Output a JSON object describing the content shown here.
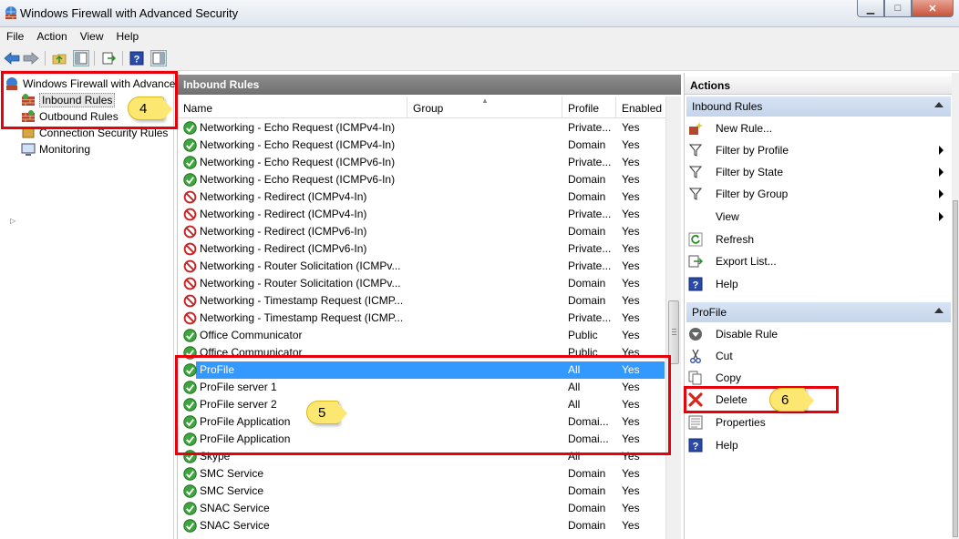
{
  "window": {
    "title": "Windows Firewall with Advanced Security",
    "min": "▁",
    "max": "□",
    "close": "✕"
  },
  "menu": [
    "File",
    "Action",
    "View",
    "Help"
  ],
  "tree": {
    "root": "Windows Firewall with Advance",
    "inbound": "Inbound Rules",
    "outbound": "Outbound Rules",
    "connection": "Connection Security Rules",
    "monitoring": "Monitoring"
  },
  "middle": {
    "header": "Inbound Rules",
    "columns": {
      "name": "Name",
      "group": "Group",
      "profile": "Profile",
      "enabled": "Enabled"
    },
    "rows": [
      {
        "status": "allow",
        "name": "Networking - Echo Request (ICMPv4-In)",
        "profile": "Private...",
        "enabled": "Yes"
      },
      {
        "status": "allow",
        "name": "Networking - Echo Request (ICMPv4-In)",
        "profile": "Domain",
        "enabled": "Yes"
      },
      {
        "status": "allow",
        "name": "Networking - Echo Request (ICMPv6-In)",
        "profile": "Private...",
        "enabled": "Yes"
      },
      {
        "status": "allow",
        "name": "Networking - Echo Request (ICMPv6-In)",
        "profile": "Domain",
        "enabled": "Yes"
      },
      {
        "status": "block",
        "name": "Networking - Redirect (ICMPv4-In)",
        "profile": "Domain",
        "enabled": "Yes"
      },
      {
        "status": "block",
        "name": "Networking - Redirect (ICMPv4-In)",
        "profile": "Private...",
        "enabled": "Yes"
      },
      {
        "status": "block",
        "name": "Networking - Redirect (ICMPv6-In)",
        "profile": "Domain",
        "enabled": "Yes"
      },
      {
        "status": "block",
        "name": "Networking - Redirect (ICMPv6-In)",
        "profile": "Private...",
        "enabled": "Yes"
      },
      {
        "status": "block",
        "name": "Networking - Router Solicitation (ICMPv...",
        "profile": "Private...",
        "enabled": "Yes"
      },
      {
        "status": "block",
        "name": "Networking - Router Solicitation (ICMPv...",
        "profile": "Domain",
        "enabled": "Yes"
      },
      {
        "status": "block",
        "name": "Networking - Timestamp Request (ICMP...",
        "profile": "Domain",
        "enabled": "Yes"
      },
      {
        "status": "block",
        "name": "Networking - Timestamp Request (ICMP...",
        "profile": "Private...",
        "enabled": "Yes"
      },
      {
        "status": "allow",
        "name": "Office Communicator",
        "profile": "Public",
        "enabled": "Yes"
      },
      {
        "status": "allow",
        "name": "Office Communicator",
        "profile": "Public",
        "enabled": "Yes"
      },
      {
        "status": "allow",
        "name": "ProFile",
        "profile": "All",
        "enabled": "Yes",
        "selected": true
      },
      {
        "status": "allow",
        "name": "ProFile server 1",
        "profile": "All",
        "enabled": "Yes"
      },
      {
        "status": "allow",
        "name": "ProFile server 2",
        "profile": "All",
        "enabled": "Yes"
      },
      {
        "status": "allow",
        "name": "ProFile Application",
        "profile": "Domai...",
        "enabled": "Yes"
      },
      {
        "status": "allow",
        "name": "ProFile Application",
        "profile": "Domai...",
        "enabled": "Yes"
      },
      {
        "status": "allow",
        "name": "Skype",
        "profile": "All",
        "enabled": "Yes"
      },
      {
        "status": "allow",
        "name": "SMC Service",
        "profile": "Domain",
        "enabled": "Yes"
      },
      {
        "status": "allow",
        "name": "SMC Service",
        "profile": "Domain",
        "enabled": "Yes"
      },
      {
        "status": "allow",
        "name": "SNAC Service",
        "profile": "Domain",
        "enabled": "Yes"
      },
      {
        "status": "allow",
        "name": "SNAC Service",
        "profile": "Domain",
        "enabled": "Yes"
      }
    ]
  },
  "actions": {
    "title": "Actions",
    "section1": "Inbound Rules",
    "new_rule": "New Rule...",
    "filter_profile": "Filter by Profile",
    "filter_state": "Filter by State",
    "filter_group": "Filter by Group",
    "view": "View",
    "refresh": "Refresh",
    "export": "Export List...",
    "help1": "Help",
    "section2": "ProFile",
    "disable": "Disable Rule",
    "cut": "Cut",
    "copy": "Copy",
    "delete": "Delete",
    "properties": "Properties",
    "help2": "Help"
  },
  "callouts": {
    "c4": "4",
    "c5": "5",
    "c6": "6"
  },
  "colors": {
    "accent": "#3399ff",
    "annotation": "#e8000a",
    "callout": "#fce870"
  }
}
